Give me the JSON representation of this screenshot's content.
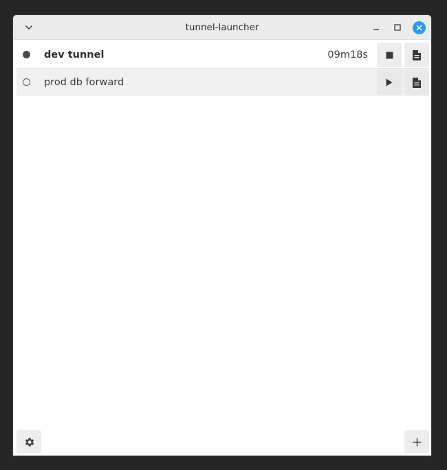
{
  "window": {
    "title": "tunnel-launcher"
  },
  "tunnels": [
    {
      "name": "dev tunnel",
      "status": "running",
      "uptime": "09m18s",
      "primary_action_icon": "stop-icon",
      "log_icon": "document-icon"
    },
    {
      "name": "prod db forward",
      "status": "stopped",
      "uptime": "",
      "primary_action_icon": "play-icon",
      "log_icon": "document-icon"
    }
  ],
  "toolbar": {
    "settings_icon": "gear-icon",
    "add_icon": "plus-icon"
  },
  "colors": {
    "accent": "#2e9ae8",
    "titlebar": "#ebebeb",
    "row_selected": "#f0f0f0"
  }
}
